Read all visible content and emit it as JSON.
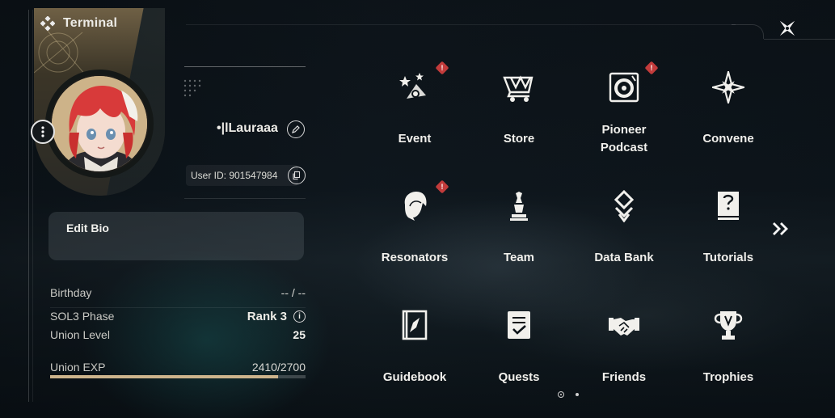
{
  "header": {
    "title": "Terminal",
    "icon": "diamond-cluster-icon"
  },
  "close": {
    "icon": "close-star-icon"
  },
  "profile": {
    "username": "•|lLauraaa",
    "user_id_label": "User ID: 901547984",
    "edit_bio_label": "Edit Bio"
  },
  "stats": {
    "birthday_label": "Birthday",
    "birthday_value": "-- / --",
    "phase_label": "SOL3 Phase",
    "phase_value": "Rank 3",
    "union_level_label": "Union Level",
    "union_level_value": "25",
    "union_exp_label": "Union EXP",
    "union_exp_value": "2410/2700",
    "union_exp_current": 2410,
    "union_exp_max": 2700
  },
  "menu": {
    "event": {
      "label": "Event",
      "icon": "event-icon",
      "badge": "!"
    },
    "store": {
      "label": "Store",
      "icon": "cart-icon"
    },
    "podcast": {
      "label": "Pioneer Podcast",
      "label_line1": "Pioneer",
      "label_line2": "Podcast",
      "icon": "record-player-icon",
      "badge": "!"
    },
    "convene": {
      "label": "Convene",
      "icon": "compass-star-icon"
    },
    "resonators": {
      "label": "Resonators",
      "icon": "character-head-icon",
      "badge": "!"
    },
    "team": {
      "label": "Team",
      "icon": "chess-pieces-icon"
    },
    "databank": {
      "label": "Data Bank",
      "icon": "data-bank-icon"
    },
    "tutorials": {
      "label": "Tutorials",
      "icon": "question-book-icon"
    },
    "guidebook": {
      "label": "Guidebook",
      "icon": "guidebook-compass-icon"
    },
    "quests": {
      "label": "Quests",
      "icon": "quest-checklist-icon"
    },
    "friends": {
      "label": "Friends",
      "icon": "handshake-icon"
    },
    "trophies": {
      "label": "Trophies",
      "icon": "trophy-icon"
    }
  },
  "pagination": {
    "current_page": 1,
    "total_pages": 2
  },
  "colors": {
    "accent": "#cdb48c",
    "badge": "#c23b3b",
    "text": "#f1f0ec"
  }
}
